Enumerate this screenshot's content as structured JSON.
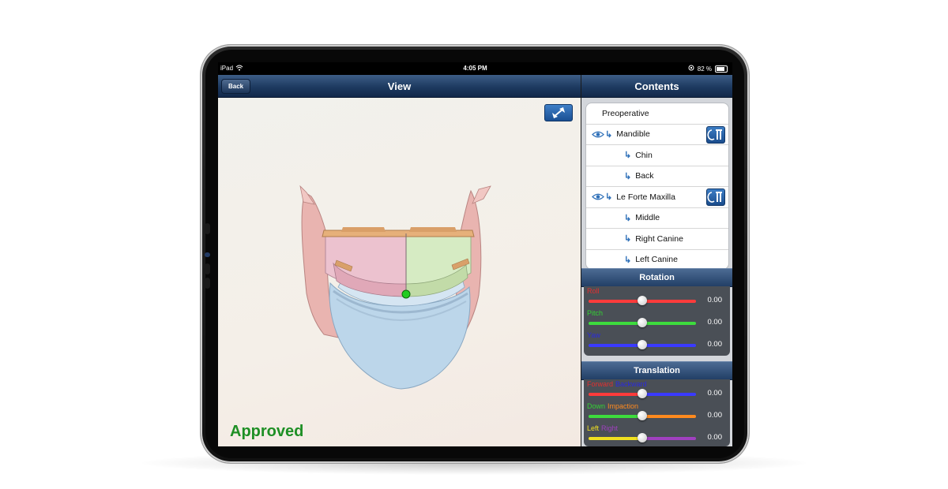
{
  "status_bar": {
    "device": "iPad",
    "time": "4:05 PM",
    "battery": "82 %"
  },
  "view_header": {
    "title": "View",
    "back_label": "Back"
  },
  "contents_header": {
    "title": "Contents"
  },
  "viewport": {
    "stamp": "Approved",
    "stamp_color": "#1e8f25"
  },
  "contents": {
    "items": [
      {
        "label": "Preoperative",
        "level": 0,
        "eye": false,
        "arrow": false,
        "edit": false
      },
      {
        "label": "Mandible",
        "level": 0,
        "eye": true,
        "arrow": true,
        "edit": true
      },
      {
        "label": "Chin",
        "level": 1,
        "eye": false,
        "arrow": true,
        "edit": false
      },
      {
        "label": "Back",
        "level": 1,
        "eye": false,
        "arrow": true,
        "edit": false
      },
      {
        "label": "Le Forte Maxilla",
        "level": 0,
        "eye": true,
        "arrow": true,
        "edit": true
      },
      {
        "label": "Middle",
        "level": 1,
        "eye": false,
        "arrow": true,
        "edit": false
      },
      {
        "label": "Right Canine",
        "level": 1,
        "eye": false,
        "arrow": true,
        "edit": false
      },
      {
        "label": "Left Canine",
        "level": 1,
        "eye": false,
        "arrow": true,
        "edit": false
      }
    ]
  },
  "rotation": {
    "title": "Rotation",
    "sliders": [
      {
        "label": "Roll",
        "label_color": "#e23030",
        "track": "#ff3b3b",
        "value": "0.00",
        "pos": 0.5
      },
      {
        "label": "Pitch",
        "label_color": "#33d133",
        "track": "#3ddc3d",
        "value": "0.00",
        "pos": 0.5
      },
      {
        "label": "Yaw",
        "label_color": "#2a2ae0",
        "track": "#3a3aff",
        "value": "0.00",
        "pos": 0.5
      }
    ]
  },
  "translation": {
    "title": "Translation",
    "sliders": [
      {
        "labels": [
          {
            "text": "Forward",
            "color": "#e23030"
          },
          {
            "text": "Backward",
            "color": "#2a2ae0"
          }
        ],
        "track_left": "#ff3b3b",
        "track_right": "#3a3aff",
        "value": "0.00",
        "pos": 0.5
      },
      {
        "labels": [
          {
            "text": "Down",
            "color": "#33d133"
          },
          {
            "text": "Impaction",
            "color": "#ff8a1e"
          }
        ],
        "track_left": "#3ddc3d",
        "track_right": "#ff8a1e",
        "value": "0.00",
        "pos": 0.5
      },
      {
        "labels": [
          {
            "text": "Left",
            "color": "#f0e020"
          },
          {
            "text": "Right",
            "color": "#a040c0"
          }
        ],
        "track_left": "#f0e020",
        "track_right": "#a040c0",
        "value": "0.00",
        "pos": 0.5
      }
    ]
  }
}
